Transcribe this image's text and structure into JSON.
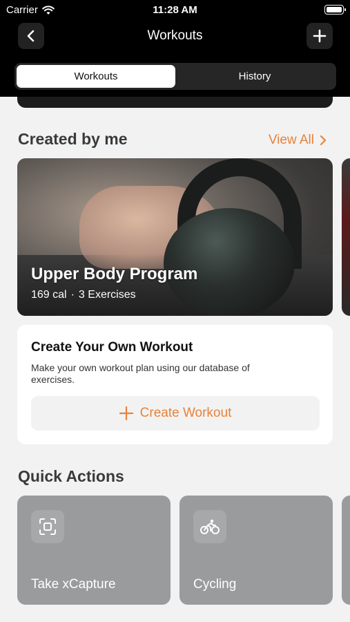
{
  "status_bar": {
    "carrier": "Carrier",
    "time": "11:28 AM"
  },
  "nav": {
    "title": "Workouts"
  },
  "tabs": [
    {
      "label": "Workouts",
      "active": true
    },
    {
      "label": "History",
      "active": false
    }
  ],
  "created_by_me": {
    "title": "Created by me",
    "view_all": "View All",
    "program": {
      "title": "Upper Body Program",
      "calories": "169 cal",
      "separator": "·",
      "exercises": "3 Exercises"
    }
  },
  "create_card": {
    "title": "Create Your Own Workout",
    "description": "Make your own workout plan using our database of exercises.",
    "button": "Create Workout"
  },
  "quick_actions": {
    "title": "Quick Actions",
    "items": [
      {
        "label": "Take xCapture",
        "icon": "scan-icon"
      },
      {
        "label": "Cycling",
        "icon": "cycling-icon"
      }
    ]
  },
  "colors": {
    "accent": "#e8823a",
    "header": "#000000",
    "background": "#f2f2f2",
    "quick_action_card": "#9a9b9d"
  }
}
